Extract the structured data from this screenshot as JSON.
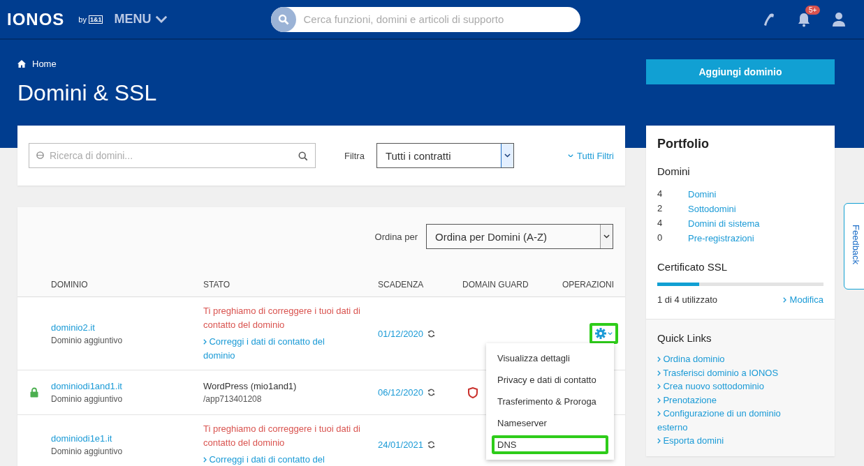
{
  "header": {
    "logo": "IONOS",
    "logo_by": "by",
    "logo_badge": "1&1",
    "menu": "MENU",
    "search_placeholder": "Cerca funzioni, domini e articoli di supporto",
    "notifications_badge": "5+"
  },
  "hero": {
    "breadcrumb": "Home",
    "title": "Domini & SSL",
    "add_button": "Aggiungi dominio"
  },
  "filter": {
    "search_placeholder": "Ricerca di domini...",
    "label": "Filtra",
    "value": "Tutti i contratti",
    "all_filters": "Tutti Filtri"
  },
  "table": {
    "sort_label": "Ordina per",
    "sort_value": "Ordina per Domini (A-Z)",
    "columns": [
      "DOMINIO",
      "STATO",
      "SCADENZA",
      "DOMAIN GUARD",
      "OPERAZIONI"
    ],
    "rows": [
      {
        "domain": "dominio2.it",
        "type": "Dominio aggiuntivo",
        "secure": false,
        "status": {
          "kind": "warning",
          "text": "Ti preghiamo di correggere i tuoi dati di contatto del dominio",
          "link": "Correggi i dati di contatto del dominio"
        },
        "expiry": "01/12/2020",
        "guard": false,
        "actions": true
      },
      {
        "domain": "dominiodi1and1.it",
        "type": "Dominio aggiuntivo",
        "secure": true,
        "status": {
          "kind": "app",
          "text": "WordPress (mio1and1)",
          "sub": "/app713401208"
        },
        "expiry": "06/12/2020",
        "guard": true,
        "actions": false
      },
      {
        "domain": "dominiodi1e1.it",
        "type": "Dominio aggiuntivo",
        "secure": false,
        "status": {
          "kind": "warning",
          "text": "Ti preghiamo di correggere i tuoi dati di contatto del dominio",
          "link": "Correggi i dati di contatto del"
        },
        "expiry": "24/01/2021",
        "guard": false,
        "actions": false
      }
    ]
  },
  "actions_menu": [
    {
      "label": "Visualizza dettagli",
      "highlighted": false
    },
    {
      "label": "Privacy e dati di contatto",
      "highlighted": false
    },
    {
      "label": "Trasferimento & Proroga",
      "highlighted": false
    },
    {
      "label": "Nameserver",
      "highlighted": false
    },
    {
      "label": "DNS",
      "highlighted": true
    }
  ],
  "sidebar": {
    "title": "Portfolio",
    "domains_title": "Domini",
    "counts": [
      {
        "count": "4",
        "label": "Domini"
      },
      {
        "count": "2",
        "label": "Sottodomini"
      },
      {
        "count": "4",
        "label": "Domini di sistema"
      },
      {
        "count": "0",
        "label": "Pre-registrazioni"
      }
    ],
    "ssl_title": "Certificato SSL",
    "ssl_bar": {
      "level": 0.25
    },
    "ssl_usage": "1 di 4 utilizzato",
    "ssl_link": "Modifica",
    "quick_links_title": "Quick Links",
    "quick_links": [
      "Ordina dominio",
      "Trasferisci dominio a IONOS",
      "Crea nuovo sottodominio",
      "Prenotazione",
      "Configurazione di un dominio esterno",
      "Esporta domini"
    ]
  },
  "feedback": "Feedback"
}
